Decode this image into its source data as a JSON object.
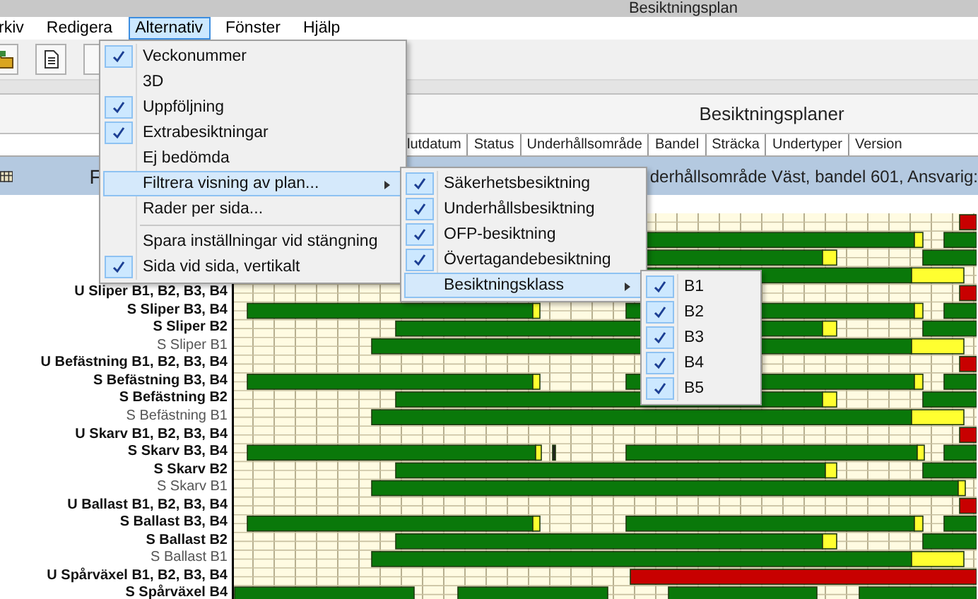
{
  "window": {
    "title": "Besiktningsplan"
  },
  "menu_bar": [
    {
      "label": "rkiv",
      "selected": false
    },
    {
      "label": "Redigera",
      "selected": false
    },
    {
      "label": "Alternativ",
      "selected": true
    },
    {
      "label": "Fönster",
      "selected": false
    },
    {
      "label": "Hjälp",
      "selected": false
    }
  ],
  "panel": {
    "title": "Besiktningsplaner",
    "columns": [
      "lutdatum",
      "Status",
      "Underhållsområde",
      "Bandel",
      "Sträcka",
      "Undertyper",
      "Version"
    ],
    "group_header": {
      "prefix": "F",
      "text": "derhållsområde Väst, bandel 601, Ansvarig:"
    }
  },
  "chart": {
    "rows": [
      {
        "label": "U Sliper B1, B2, B3, B4",
        "bold": true
      },
      {
        "label": "S Sliper B3, B4",
        "bold": true
      },
      {
        "label": "S Sliper B2",
        "bold": true
      },
      {
        "label": "S Sliper B1",
        "bold": false
      },
      {
        "label": "U Befästning B1, B2, B3, B4",
        "bold": true
      },
      {
        "label": "S Befästning B3, B4",
        "bold": true
      },
      {
        "label": "S Befästning B2",
        "bold": true
      },
      {
        "label": "S Befästning B1",
        "bold": false
      },
      {
        "label": "U Skarv B1, B2, B3, B4",
        "bold": true
      },
      {
        "label": "S Skarv B3, B4",
        "bold": true
      },
      {
        "label": "S Skarv B2",
        "bold": true
      },
      {
        "label": "S Skarv B1",
        "bold": false
      },
      {
        "label": "U Ballast B1, B2, B3, B4",
        "bold": true
      },
      {
        "label": "S Ballast B3, B4",
        "bold": true
      },
      {
        "label": "S Ballast B2",
        "bold": true
      },
      {
        "label": "S Ballast B1",
        "bold": false
      },
      {
        "label": "U Spårväxel B1, B2, B3, B4",
        "bold": true
      },
      {
        "label": "S Spårväxel B4",
        "bold": true
      }
    ]
  },
  "menu": {
    "items": [
      {
        "kind": "check",
        "label": "Veckonummer",
        "checked": true
      },
      {
        "kind": "check",
        "label": "3D",
        "checked": false
      },
      {
        "kind": "check",
        "label": "Uppföljning",
        "checked": true
      },
      {
        "kind": "check",
        "label": "Extrabesiktningar",
        "checked": true
      },
      {
        "kind": "check",
        "label": "Ej bedömda",
        "checked": false
      },
      {
        "kind": "submenu",
        "label": "Filtrera visning av plan...",
        "selected": true
      },
      {
        "kind": "check",
        "label": "Rader per sida...",
        "checked": false
      },
      {
        "kind": "separator"
      },
      {
        "kind": "check",
        "label": "Spara inställningar vid stängning",
        "checked": false
      },
      {
        "kind": "check",
        "label": "Sida vid sida, vertikalt",
        "checked": true
      }
    ]
  },
  "submenu": {
    "items": [
      {
        "kind": "check",
        "label": "Säkerhetsbesiktning",
        "checked": true
      },
      {
        "kind": "check",
        "label": "Underhållsbesiktning",
        "checked": true
      },
      {
        "kind": "check",
        "label": "OFP-besiktning",
        "checked": true
      },
      {
        "kind": "check",
        "label": "Övertagandebesiktning",
        "checked": true
      },
      {
        "kind": "submenu",
        "label": "Besiktningsklass",
        "selected": true
      }
    ]
  },
  "class_submenu": {
    "items": [
      {
        "kind": "check",
        "label": "B1",
        "checked": true
      },
      {
        "kind": "check",
        "label": "B2",
        "checked": true
      },
      {
        "kind": "check",
        "label": "B3",
        "checked": true
      },
      {
        "kind": "check",
        "label": "B4",
        "checked": true
      },
      {
        "kind": "check",
        "label": "B5",
        "checked": true
      }
    ]
  }
}
